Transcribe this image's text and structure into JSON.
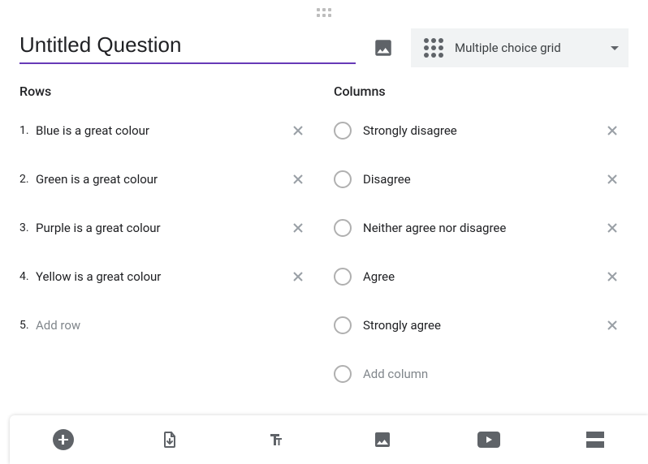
{
  "question": {
    "title": "Untitled Question"
  },
  "qtype": {
    "label": "Multiple choice grid"
  },
  "rows": {
    "heading": "Rows",
    "items": [
      {
        "num": "1.",
        "text": "Blue is a great colour"
      },
      {
        "num": "2.",
        "text": "Green is a great colour"
      },
      {
        "num": "3.",
        "text": "Purple is a great colour"
      },
      {
        "num": "4.",
        "text": "Yellow is a great colour"
      }
    ],
    "add_num": "5.",
    "add_placeholder": "Add row"
  },
  "columns": {
    "heading": "Columns",
    "items": [
      {
        "text": "Strongly disagree"
      },
      {
        "text": "Disagree"
      },
      {
        "text": "Neither agree nor disagree"
      },
      {
        "text": "Agree"
      },
      {
        "text": "Strongly agree"
      }
    ],
    "add_placeholder": "Add column"
  }
}
